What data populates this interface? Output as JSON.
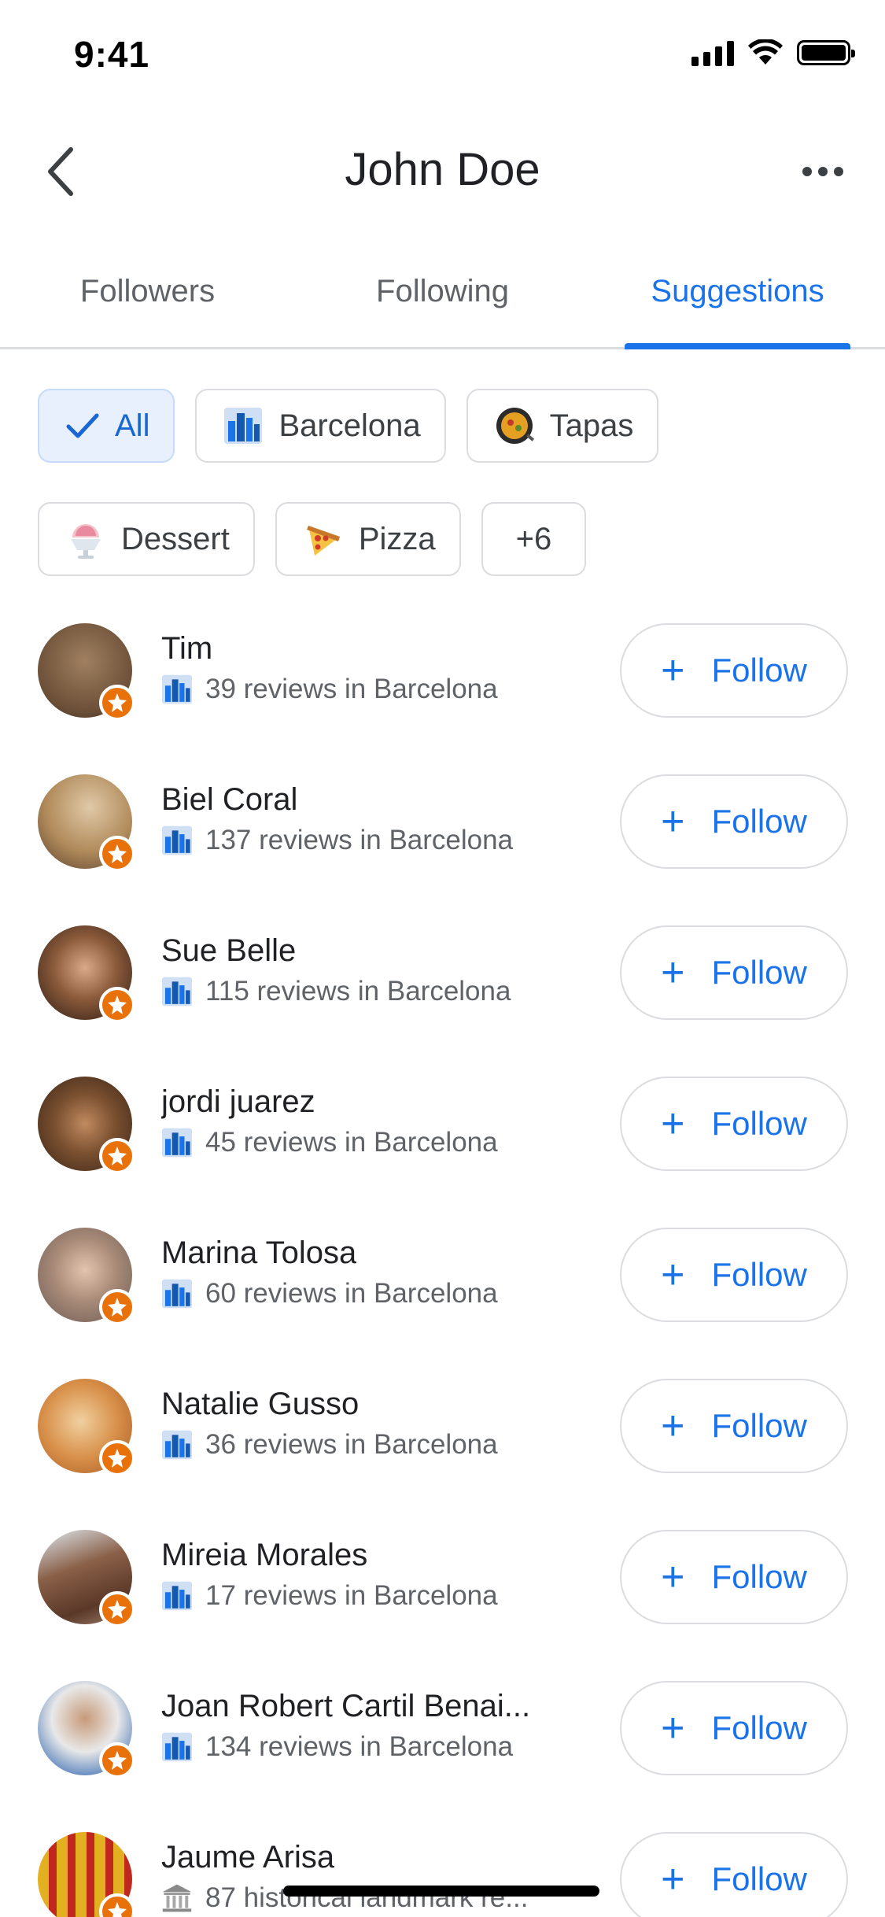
{
  "status_bar": {
    "time": "9:41"
  },
  "header": {
    "title": "John Doe"
  },
  "tabs": [
    {
      "label": "Followers",
      "active": false
    },
    {
      "label": "Following",
      "active": false
    },
    {
      "label": "Suggestions",
      "active": true
    }
  ],
  "chips": [
    {
      "label": "All",
      "icon": "check-icon",
      "selected": true
    },
    {
      "label": "Barcelona",
      "icon": "city-icon",
      "selected": false
    },
    {
      "label": "Tapas",
      "icon": "paella-icon",
      "selected": false
    },
    {
      "label": "Dessert",
      "icon": "shaved-ice-icon",
      "selected": false
    },
    {
      "label": "Pizza",
      "icon": "pizza-icon",
      "selected": false
    },
    {
      "label": "+6",
      "icon": "",
      "selected": false
    }
  ],
  "people": [
    {
      "name": "Tim",
      "meta": "39 reviews in Barcelona",
      "meta_icon": "city-icon",
      "follow_label": "Follow",
      "avatar_color": "#8a6a4a"
    },
    {
      "name": "Biel Coral",
      "meta": "137 reviews in Barcelona",
      "meta_icon": "city-icon",
      "follow_label": "Follow",
      "avatar_color": "#b08a5a"
    },
    {
      "name": "Sue Belle",
      "meta": "115 reviews in Barcelona",
      "meta_icon": "city-icon",
      "follow_label": "Follow",
      "avatar_color": "#5a3a2a"
    },
    {
      "name": "jordi juarez",
      "meta": "45 reviews in Barcelona",
      "meta_icon": "city-icon",
      "follow_label": "Follow",
      "avatar_color": "#6a4a30"
    },
    {
      "name": "Marina Tolosa",
      "meta": "60 reviews in Barcelona",
      "meta_icon": "city-icon",
      "follow_label": "Follow",
      "avatar_color": "#b9b4ae"
    },
    {
      "name": "Natalie Gusso",
      "meta": "36 reviews in Barcelona",
      "meta_icon": "city-icon",
      "follow_label": "Follow",
      "avatar_color": "#d8a060"
    },
    {
      "name": "Mireia Morales",
      "meta": "17 reviews in Barcelona",
      "meta_icon": "city-icon",
      "follow_label": "Follow",
      "avatar_color": "#7a5040"
    },
    {
      "name": "Joan Robert Cartil Benai...",
      "meta": "134 reviews in Barcelona",
      "meta_icon": "city-icon",
      "follow_label": "Follow",
      "avatar_color": "#c8c8c8"
    },
    {
      "name": "Jaume Arisa",
      "meta": "87 historical landmark re...",
      "meta_icon": "landmark-icon",
      "follow_label": "Follow",
      "avatar_color": "#d4a020"
    }
  ],
  "colors": {
    "accent": "#1a73e8",
    "guide_badge": "#e8710a",
    "chip_selected_bg": "#e8f0fe"
  }
}
